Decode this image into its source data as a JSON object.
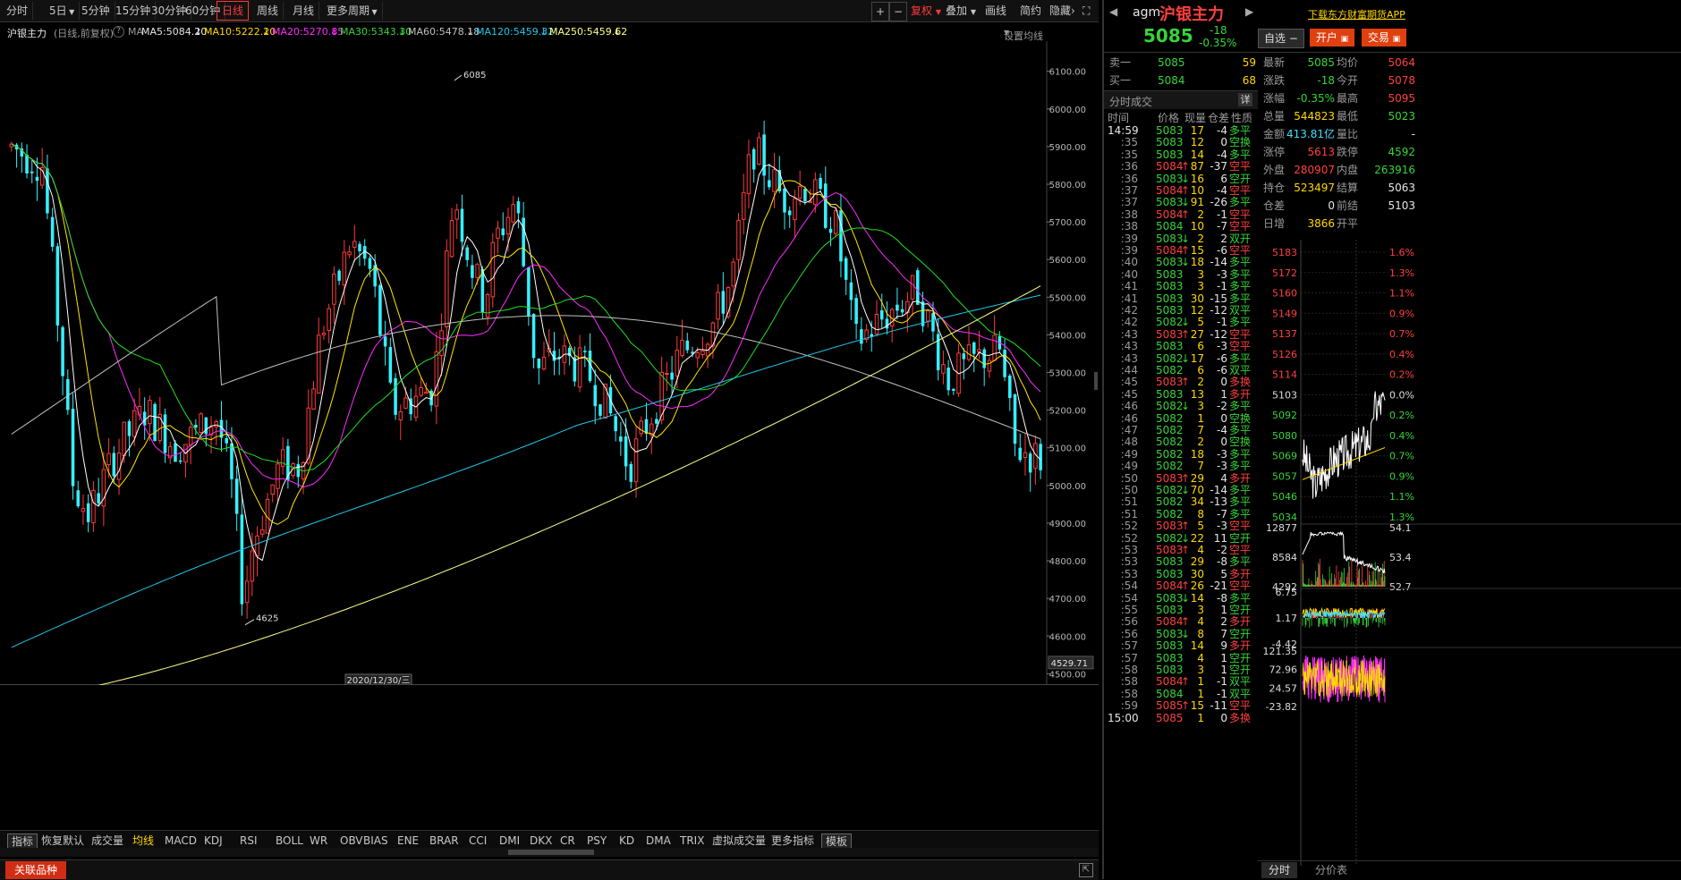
{
  "periods": [
    "分时",
    "5日",
    "5分钟",
    "15分钟",
    "30分钟",
    "60分钟",
    "日线",
    "周线",
    "月线",
    "更多周期"
  ],
  "active_period": "日线",
  "tools": {
    "plus": "+",
    "minus": "−",
    "fuquan": "复权",
    "overlay": "叠加",
    "draw": "画线",
    "simple": "简约",
    "hide": "隐藏"
  },
  "ma": {
    "name": "沪银主力",
    "mode": "(日线,前复权)",
    "ma_label": "MA",
    "ma5": "MA5:5084.20",
    "ma10": "MA10:5222.20",
    "ma20": "MA20:5270.85",
    "ma30": "MA30:5343.30",
    "ma60": "MA60:5478.18",
    "ma120": "MA120:5459.32",
    "ma250": "MA250:5459.62",
    "settings": "设置均线"
  },
  "chart_data": {
    "type": "candlestick",
    "ylim": [
      4470,
      6180
    ],
    "yticks": [
      "6100.00",
      "6000.00",
      "5900.00",
      "5800.00",
      "5700.00",
      "5600.00",
      "5500.00",
      "5400.00",
      "5300.00",
      "5200.00",
      "5100.00",
      "5000.00",
      "4900.00",
      "4800.00",
      "4700.00",
      "4600.00",
      "4500.00"
    ],
    "current_price_label": "4529.71",
    "high_label": "6085",
    "low_label": "4625",
    "date_label": "2020/12/30/三",
    "colors": {
      "up": "#ff3a3a",
      "down": "#35f0ff",
      "ma5": "#ffffff",
      "ma10": "#ffe600",
      "ma20": "#ff2bff",
      "ma30": "#20e020",
      "ma60": "#c0c0c0",
      "ma120": "#22c8e8",
      "ma250": "#ffff88"
    }
  },
  "indicators": [
    "指标",
    "恢复默认",
    "成交量",
    "均线",
    "MACD",
    "KDJ",
    "RSI",
    "BOLL",
    "WR",
    "OBV",
    "BIAS",
    "ENE",
    "BRAR",
    "CCI",
    "DMI",
    "DKX",
    "CR",
    "PSY",
    "KD",
    "DMA",
    "TRIX",
    "虚拟成交量",
    "更多指标",
    "模板"
  ],
  "related": "关联品种",
  "quote": {
    "code": "agm",
    "name": "沪银主力",
    "price": "5085",
    "change": "-18",
    "pct": "-0.35%",
    "fav": "自选",
    "open_pos": "开户",
    "trade": "交易",
    "download": "下载东方财富期货APP"
  },
  "book": {
    "sell_label": "卖一",
    "sell_price": "5085",
    "sell_vol": "59",
    "buy_label": "买一",
    "buy_price": "5084",
    "buy_vol": "68"
  },
  "stats": [
    {
      "l1": "最新",
      "v1": "5085",
      "l2": "均价",
      "v2": "5064"
    },
    {
      "l1": "涨跌",
      "v1": "-18",
      "l2": "今开",
      "v2": "5078"
    },
    {
      "l1": "涨幅",
      "v1": "-0.35%",
      "l2": "最高",
      "v2": "5095"
    },
    {
      "l1": "总量",
      "v1": "544823",
      "l2": "最低",
      "v2": "5023"
    },
    {
      "l1": "金额",
      "v1": "413.81亿",
      "l2": "量比",
      "v2": "-"
    },
    {
      "l1": "涨停",
      "v1": "5613",
      "l2": "跌停",
      "v2": "4592"
    },
    {
      "l1": "外盘",
      "v1": "280907",
      "l2": "内盘",
      "v2": "263916"
    },
    {
      "l1": "持仓",
      "v1": "523497",
      "l2": "结算",
      "v2": "5063"
    },
    {
      "l1": "仓差",
      "v1": "0",
      "l2": "前结",
      "v2": "5103"
    },
    {
      "l1": "日增",
      "v1": "3866",
      "l2": "开平",
      "v2": ""
    }
  ],
  "trades_title": "分时成交",
  "trades_detail": "详",
  "trades_header": {
    "time": "时间",
    "price": "价格",
    "vol": "现量",
    "oi": "仓差",
    "nature": "性质"
  },
  "trades": [
    {
      "t": "14:59",
      "p": "5083",
      "a": "",
      "v": "17",
      "o": "-4",
      "n": "多平"
    },
    {
      "t": ":35",
      "p": "5083",
      "a": "",
      "v": "12",
      "o": "0",
      "n": "空换"
    },
    {
      "t": ":35",
      "p": "5083",
      "a": "",
      "v": "14",
      "o": "-4",
      "n": "多平"
    },
    {
      "t": ":36",
      "p": "5084",
      "a": "↑",
      "v": "87",
      "o": "-37",
      "n": "空平"
    },
    {
      "t": ":36",
      "p": "5083",
      "a": "↓",
      "v": "16",
      "o": "6",
      "n": "空开"
    },
    {
      "t": ":37",
      "p": "5084",
      "a": "↑",
      "v": "10",
      "o": "-4",
      "n": "空平"
    },
    {
      "t": ":37",
      "p": "5083",
      "a": "↓",
      "v": "91",
      "o": "-26",
      "n": "多平"
    },
    {
      "t": ":38",
      "p": "5084",
      "a": "↑",
      "v": "2",
      "o": "-1",
      "n": "空平"
    },
    {
      "t": ":38",
      "p": "5084",
      "a": "",
      "v": "10",
      "o": "-7",
      "n": "空平"
    },
    {
      "t": ":39",
      "p": "5083",
      "a": "↓",
      "v": "2",
      "o": "2",
      "n": "双开"
    },
    {
      "t": ":39",
      "p": "5084",
      "a": "↑",
      "v": "15",
      "o": "-6",
      "n": "空平"
    },
    {
      "t": ":40",
      "p": "5083",
      "a": "↓",
      "v": "18",
      "o": "-14",
      "n": "多平"
    },
    {
      "t": ":40",
      "p": "5083",
      "a": "",
      "v": "3",
      "o": "-3",
      "n": "多平"
    },
    {
      "t": ":41",
      "p": "5083",
      "a": "",
      "v": "3",
      "o": "-1",
      "n": "多平"
    },
    {
      "t": ":41",
      "p": "5083",
      "a": "",
      "v": "30",
      "o": "-15",
      "n": "多平"
    },
    {
      "t": ":42",
      "p": "5083",
      "a": "",
      "v": "12",
      "o": "-12",
      "n": "双平"
    },
    {
      "t": ":42",
      "p": "5082",
      "a": "↓",
      "v": "5",
      "o": "-1",
      "n": "多平"
    },
    {
      "t": ":43",
      "p": "5083",
      "a": "↑",
      "v": "27",
      "o": "-12",
      "n": "空平"
    },
    {
      "t": ":43",
      "p": "5083",
      "a": "",
      "v": "6",
      "o": "-3",
      "n": "空平"
    },
    {
      "t": ":43",
      "p": "5082",
      "a": "↓",
      "v": "17",
      "o": "-6",
      "n": "多平"
    },
    {
      "t": ":44",
      "p": "5082",
      "a": "",
      "v": "6",
      "o": "-6",
      "n": "双平"
    },
    {
      "t": ":45",
      "p": "5083",
      "a": "↑",
      "v": "2",
      "o": "0",
      "n": "多换"
    },
    {
      "t": ":45",
      "p": "5083",
      "a": "",
      "v": "13",
      "o": "1",
      "n": "多开"
    },
    {
      "t": ":46",
      "p": "5082",
      "a": "↓",
      "v": "3",
      "o": "-2",
      "n": "多平"
    },
    {
      "t": ":46",
      "p": "5082",
      "a": "",
      "v": "1",
      "o": "0",
      "n": "空换"
    },
    {
      "t": ":47",
      "p": "5082",
      "a": "",
      "v": "7",
      "o": "-4",
      "n": "多平"
    },
    {
      "t": ":48",
      "p": "5082",
      "a": "",
      "v": "2",
      "o": "0",
      "n": "空换"
    },
    {
      "t": ":49",
      "p": "5082",
      "a": "",
      "v": "18",
      "o": "-3",
      "n": "多平"
    },
    {
      "t": ":49",
      "p": "5082",
      "a": "",
      "v": "7",
      "o": "-3",
      "n": "多平"
    },
    {
      "t": ":50",
      "p": "5083",
      "a": "↑",
      "v": "29",
      "o": "4",
      "n": "多开"
    },
    {
      "t": ":50",
      "p": "5082",
      "a": "↓",
      "v": "70",
      "o": "-14",
      "n": "多平"
    },
    {
      "t": ":51",
      "p": "5082",
      "a": "",
      "v": "34",
      "o": "-13",
      "n": "多平"
    },
    {
      "t": ":51",
      "p": "5082",
      "a": "",
      "v": "8",
      "o": "-7",
      "n": "多平"
    },
    {
      "t": ":52",
      "p": "5083",
      "a": "↑",
      "v": "5",
      "o": "-3",
      "n": "空平"
    },
    {
      "t": ":52",
      "p": "5082",
      "a": "↓",
      "v": "22",
      "o": "11",
      "n": "空开"
    },
    {
      "t": ":53",
      "p": "5083",
      "a": "↑",
      "v": "4",
      "o": "-2",
      "n": "空平"
    },
    {
      "t": ":53",
      "p": "5083",
      "a": "",
      "v": "29",
      "o": "-8",
      "n": "多平"
    },
    {
      "t": ":53",
      "p": "5083",
      "a": "",
      "v": "30",
      "o": "5",
      "n": "多开"
    },
    {
      "t": ":54",
      "p": "5084",
      "a": "↑",
      "v": "26",
      "o": "-21",
      "n": "空平"
    },
    {
      "t": ":54",
      "p": "5083",
      "a": "↓",
      "v": "14",
      "o": "-8",
      "n": "多平"
    },
    {
      "t": ":55",
      "p": "5083",
      "a": "",
      "v": "3",
      "o": "1",
      "n": "空开"
    },
    {
      "t": ":56",
      "p": "5084",
      "a": "↑",
      "v": "4",
      "o": "2",
      "n": "多开"
    },
    {
      "t": ":56",
      "p": "5083",
      "a": "↓",
      "v": "8",
      "o": "7",
      "n": "空开"
    },
    {
      "t": ":57",
      "p": "5083",
      "a": "",
      "v": "14",
      "o": "9",
      "n": "多开"
    },
    {
      "t": ":57",
      "p": "5083",
      "a": "",
      "v": "4",
      "o": "1",
      "n": "空开"
    },
    {
      "t": ":58",
      "p": "5083",
      "a": "",
      "v": "3",
      "o": "1",
      "n": "空开"
    },
    {
      "t": ":58",
      "p": "5084",
      "a": "↑",
      "v": "1",
      "o": "-1",
      "n": "双平"
    },
    {
      "t": ":58",
      "p": "5084",
      "a": "",
      "v": "1",
      "o": "-1",
      "n": "双平"
    },
    {
      "t": ":59",
      "p": "5085",
      "a": "↑",
      "v": "15",
      "o": "-11",
      "n": "空平"
    },
    {
      "t": "15:00",
      "p": "5085",
      "a": "",
      "v": "1",
      "o": "0",
      "n": "多换"
    }
  ],
  "mini": {
    "price_left": [
      "5183",
      "5172",
      "5160",
      "5149",
      "5137",
      "5126",
      "5114",
      "5103",
      "5092",
      "5080",
      "5069",
      "5057",
      "5046",
      "5034"
    ],
    "pct_right": [
      "1.6%",
      "1.3%",
      "1.1%",
      "0.9%",
      "0.7%",
      "0.4%",
      "0.2%",
      "0.0%",
      "0.2%",
      "0.4%",
      "0.7%",
      "0.9%",
      "1.1%",
      "1.3%"
    ],
    "vol_left": [
      "12877",
      "8584",
      "4292"
    ],
    "vol_right": [
      "54.1",
      "53.4",
      "52.7"
    ],
    "ind_left": [
      "6.75",
      "1.17",
      "-4.42"
    ],
    "osc_left": [
      "121.35",
      "72.96",
      "24.57",
      "-23.82"
    ],
    "tabs": [
      "分时",
      "分价表"
    ]
  }
}
